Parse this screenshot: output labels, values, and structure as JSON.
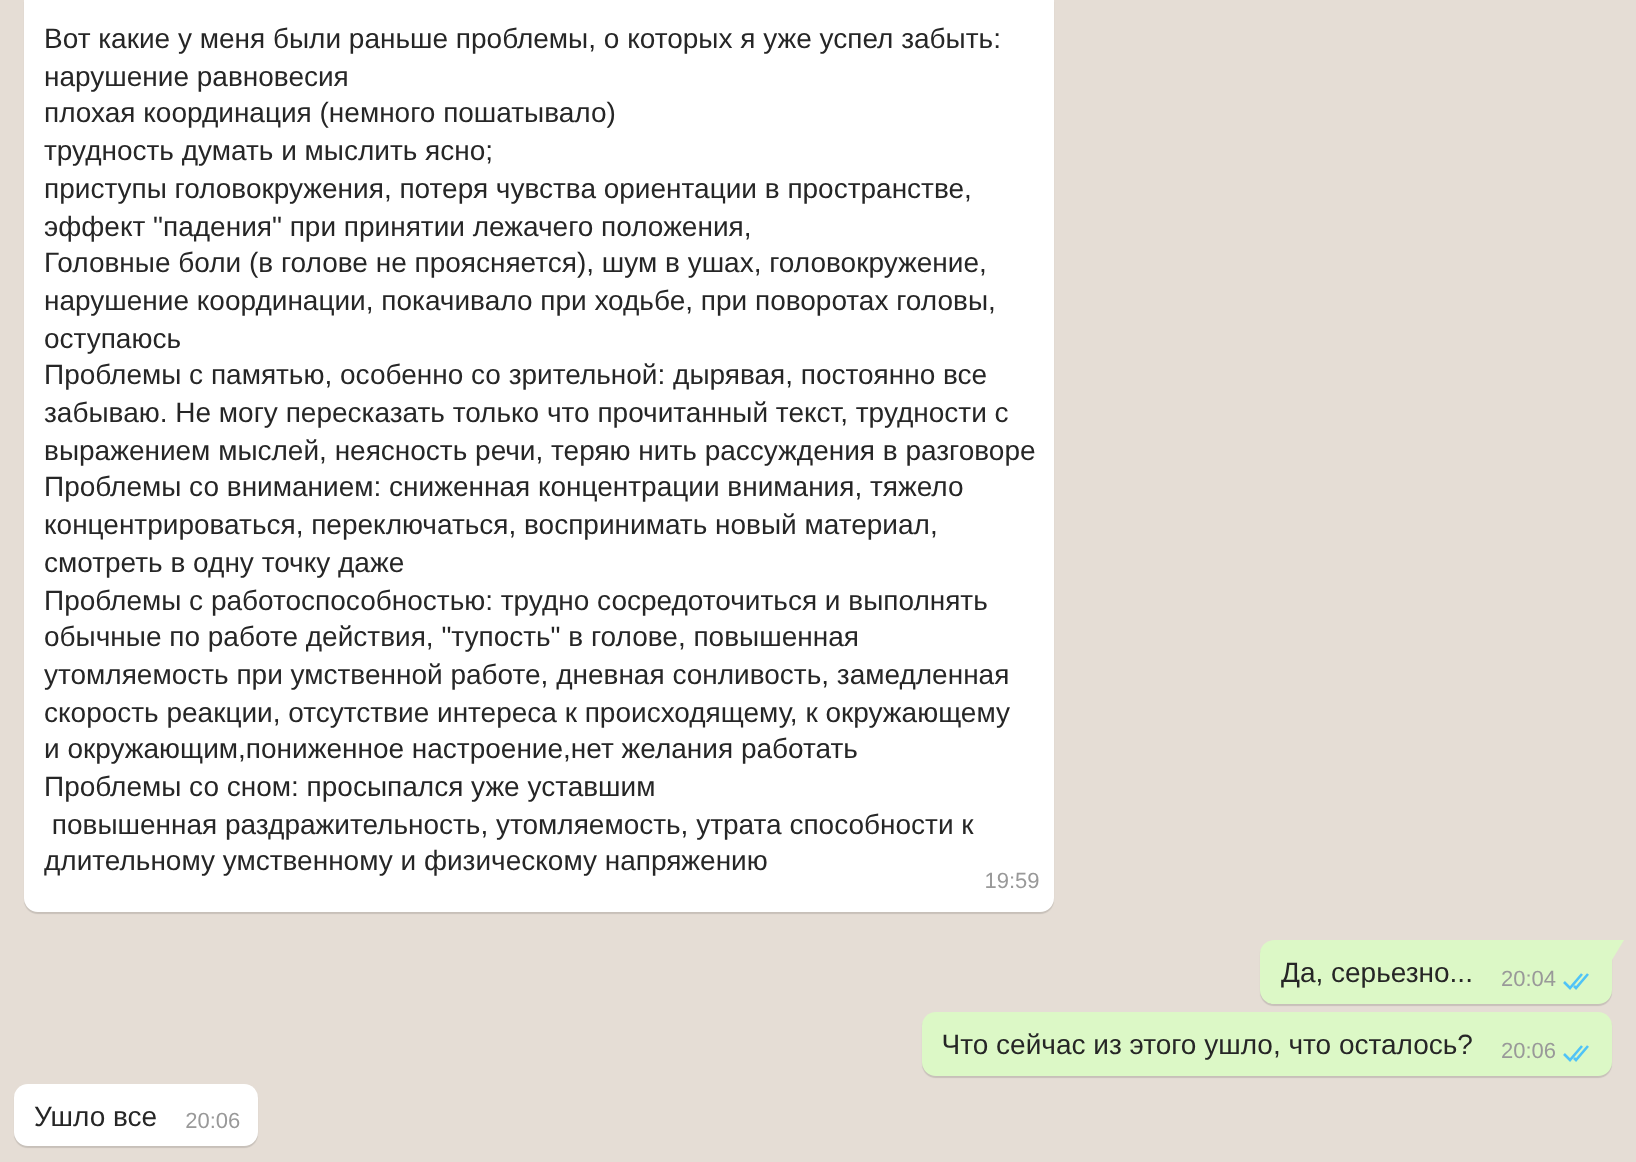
{
  "messages": [
    {
      "kind": "incoming",
      "lines": [
        "Вот какие у меня были раньше проблемы, о которых я уже успел забыть:",
        "нарушение равновесия",
        "плохая координация (немного пошатывало)",
        "трудность думать и мыслить ясно;",
        "приступы головокружения, потеря чувства ориентации в пространстве,",
        "эффект \"падения\" при принятии лежачего положения,",
        "Головные боли (в голове не проясняется), шум в ушах, головокружение,",
        "нарушение координации, покачивало при ходьбе, при поворотах головы,",
        "оступаюсь",
        "Проблемы с памятью, особенно со зрительной: дырявая, постоянно все",
        "забываю. Не могу пересказать только что прочитанный текст, трудности с",
        "выражением мыслей, неясность речи, теряю нить рассуждения в разговоре",
        "Проблемы со вниманием: сниженная концентрации внимания, тяжело",
        "концентрироваться, переключаться, воспринимать новый материал,",
        "смотреть в одну точку даже",
        "Проблемы с работоспособностью: трудно сосредоточиться и выполнять",
        "обычные по работе действия, \"тупость\" в голове, повышенная",
        "утомляемость при умственной работе, дневная сонливость, замедленная",
        "скорость реакции, отсутствие интереса к происходящему, к окружающему",
        "и окружающим,пониженное настроение,нет желания работать",
        "Проблемы со сном: просыпался уже уставшим",
        " повышенная раздражительность, утомляемость, утрата способности к",
        "длительному умственному и физическому напряжению"
      ],
      "time": "19:59"
    },
    {
      "kind": "outgoing",
      "lines": [
        "Да, серьезно..."
      ],
      "time": "20:04",
      "read": true
    },
    {
      "kind": "outgoing",
      "lines": [
        "Что сейчас из этого ушло, что осталось?"
      ],
      "time": "20:06",
      "read": true
    },
    {
      "kind": "incoming",
      "lines": [
        "Ушло все"
      ],
      "time": "20:06"
    }
  ]
}
